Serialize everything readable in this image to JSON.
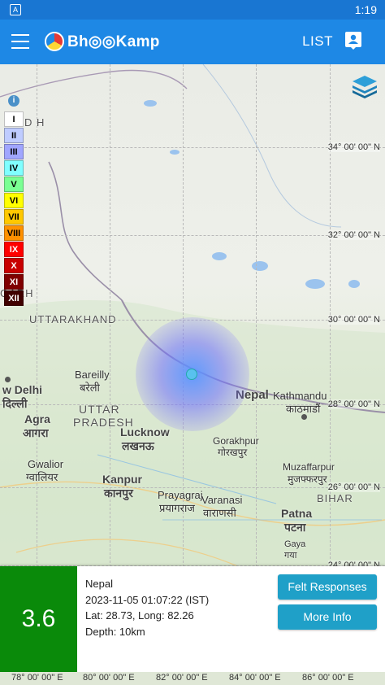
{
  "status_bar": {
    "time": "1:19",
    "notification_glyph": "A"
  },
  "app_bar": {
    "brand_text": "Bh◎◎Kamp",
    "list_label": "LIST",
    "icons": [
      "menu-icon",
      "brand-logo",
      "person-pin-icon"
    ],
    "colors": {
      "primary": "#1e88e5",
      "status": "#1976d2"
    }
  },
  "map": {
    "lat_labels": [
      "34° 00' 00\" N",
      "32° 00' 00\" N",
      "30° 00' 00\" N",
      "28° 00' 00\" N",
      "26° 00' 00\" N",
      "24° 00' 00\" N"
    ],
    "lon_labels": [
      "78° 00' 00\" E",
      "80° 00' 00\" E",
      "82° 00' 00\" E",
      "84° 00' 00\" E",
      "86° 00' 00\" E"
    ],
    "places": {
      "uttarakhand": "UTTARAKHAND",
      "garh": "GARH",
      "d_h": "D H",
      "bareilly": "Bareilly",
      "bareilly_hi": "बरेली",
      "new_delhi": "w Delhi",
      "delhi_hi": "दिल्ली",
      "uttar": "UTTAR",
      "pradesh": "PRADESH",
      "agra": "Agra",
      "agra_hi": "आगरा",
      "lucknow": "Lucknow",
      "lucknow_hi": "लखनऊ",
      "gwalior": "Gwalior",
      "gwalior_hi": "ग्वालियर",
      "kanpur": "Kanpur",
      "kanpur_hi": "कानपुर",
      "prayagraj": "Prayagraj",
      "prayagraj_hi": "प्रयागराज",
      "varanasi": "Varanasi",
      "varanasi_hi": "वाराणसी",
      "gorakhpur": "Gorakhpur",
      "gorakhpur_hi": "गोरखपुर",
      "nepal": "Nepal",
      "kathmandu": "Kathmandu",
      "kathmandu_hi": "काठमाडौं",
      "muzaffarpur": "Muzaffarpur",
      "muzaffarpur_hi": "मुजफ्फरपुर",
      "patna": "Patna",
      "patna_hi": "पटना",
      "gaya": "Gaya",
      "gaya_hi": "गया",
      "bihar": "BIHAR"
    },
    "intensity_legend": [
      {
        "label": "I",
        "color": "#ffffff",
        "text": "#000000"
      },
      {
        "label": "II",
        "color": "#bfccff",
        "text": "#000000"
      },
      {
        "label": "III",
        "color": "#a0a6ff",
        "text": "#000000"
      },
      {
        "label": "IV",
        "color": "#80ffff",
        "text": "#000000"
      },
      {
        "label": "V",
        "color": "#7aff93",
        "text": "#000000"
      },
      {
        "label": "VI",
        "color": "#ffff00",
        "text": "#000000"
      },
      {
        "label": "VII",
        "color": "#ffc800",
        "text": "#000000"
      },
      {
        "label": "VIII",
        "color": "#ff9100",
        "text": "#000000"
      },
      {
        "label": "IX",
        "color": "#ff0000",
        "text": "#ffffff"
      },
      {
        "label": "X",
        "color": "#c80000",
        "text": "#ffffff"
      },
      {
        "label": "XI",
        "color": "#800000",
        "text": "#ffffff"
      },
      {
        "label": "XII",
        "color": "#400000",
        "text": "#ffffff"
      }
    ]
  },
  "event": {
    "magnitude": "3.6",
    "magnitude_color": "#0a8a0a",
    "region": "Nepal",
    "datetime": "2023-11-05 01:07:22 (IST)",
    "latlong": "Lat: 28.73, Long: 82.26",
    "depth": "Depth: 10km",
    "felt_button": "Felt Responses",
    "more_button": "More Info"
  }
}
